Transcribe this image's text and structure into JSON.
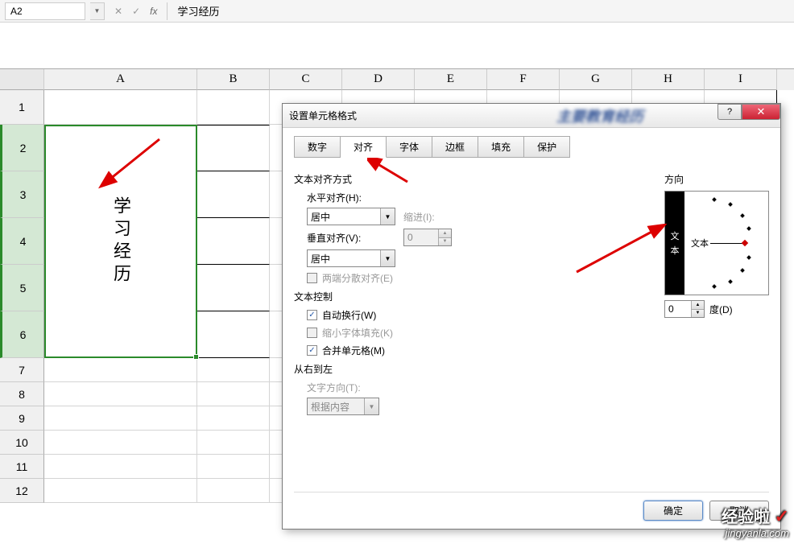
{
  "formula_bar": {
    "cell_ref": "A2",
    "cancel": "✕",
    "confirm": "✓",
    "fx": "fx",
    "content": "学习经历"
  },
  "columns": [
    "A",
    "B",
    "C",
    "D",
    "E",
    "F",
    "G",
    "H",
    "I"
  ],
  "rows": [
    "1",
    "2",
    "3",
    "4",
    "5",
    "6",
    "7",
    "8",
    "9",
    "10",
    "11",
    "12"
  ],
  "merged_cell_text": "学习经历",
  "dialog": {
    "title": "设置单元格格式",
    "blur_text": "主要教育经历",
    "help_btn": "?",
    "close_btn": "✕",
    "tabs": [
      "数字",
      "对齐",
      "字体",
      "边框",
      "填充",
      "保护"
    ],
    "active_tab": 1,
    "section_align": "文本对齐方式",
    "h_align_label": "水平对齐(H):",
    "h_align_value": "居中",
    "indent_label": "缩进(I):",
    "indent_value": "0",
    "v_align_label": "垂直对齐(V):",
    "v_align_value": "居中",
    "justify_label": "两端分散对齐(E)",
    "section_ctrl": "文本控制",
    "wrap_label": "自动换行(W)",
    "shrink_label": "缩小字体填充(K)",
    "merge_label": "合并单元格(M)",
    "section_rtl": "从右到左",
    "dir_label": "文字方向(T):",
    "dir_value": "根据内容",
    "orient_label": "方向",
    "orient_vert_text": "文本",
    "orient_horiz_text": "文本",
    "degree_value": "0",
    "degree_label": "度(D)",
    "ok_btn": "确定",
    "cancel_btn": "取消"
  },
  "watermark": {
    "top": "经验啦",
    "check": "✓",
    "bottom": "jingyanla.com"
  }
}
